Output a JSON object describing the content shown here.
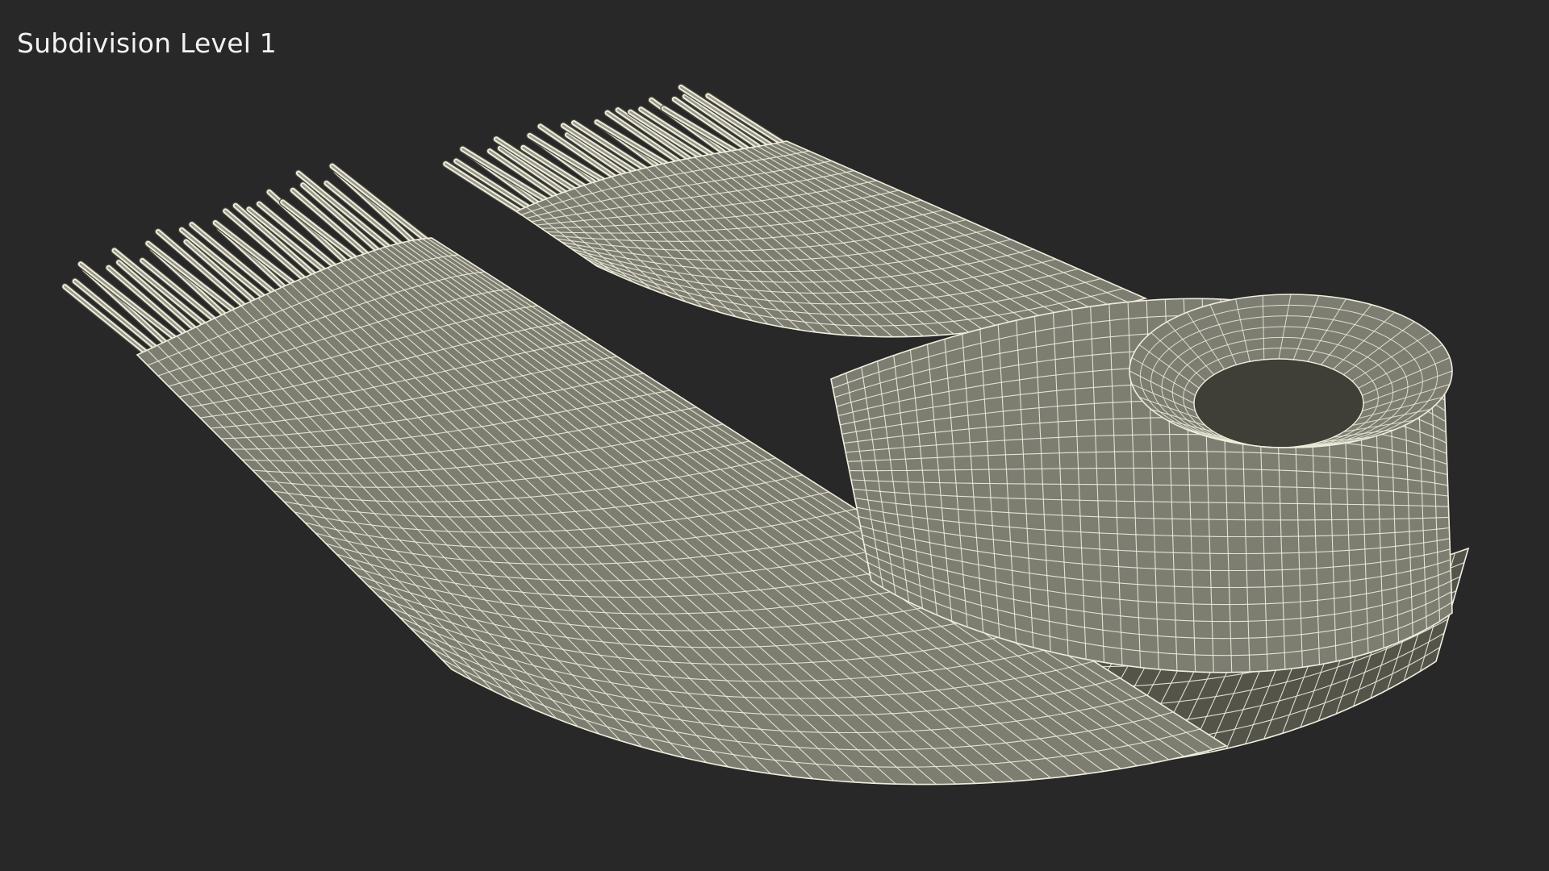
{
  "viewport": {
    "label": "Subdivision Level 1"
  },
  "model": {
    "name": "scarf-wireframe",
    "subdivision_level": 1,
    "surface_color": "#7e7d71",
    "shadow_color": "#55544b",
    "wire_color": "#efeedd",
    "background_color": "#282828"
  }
}
